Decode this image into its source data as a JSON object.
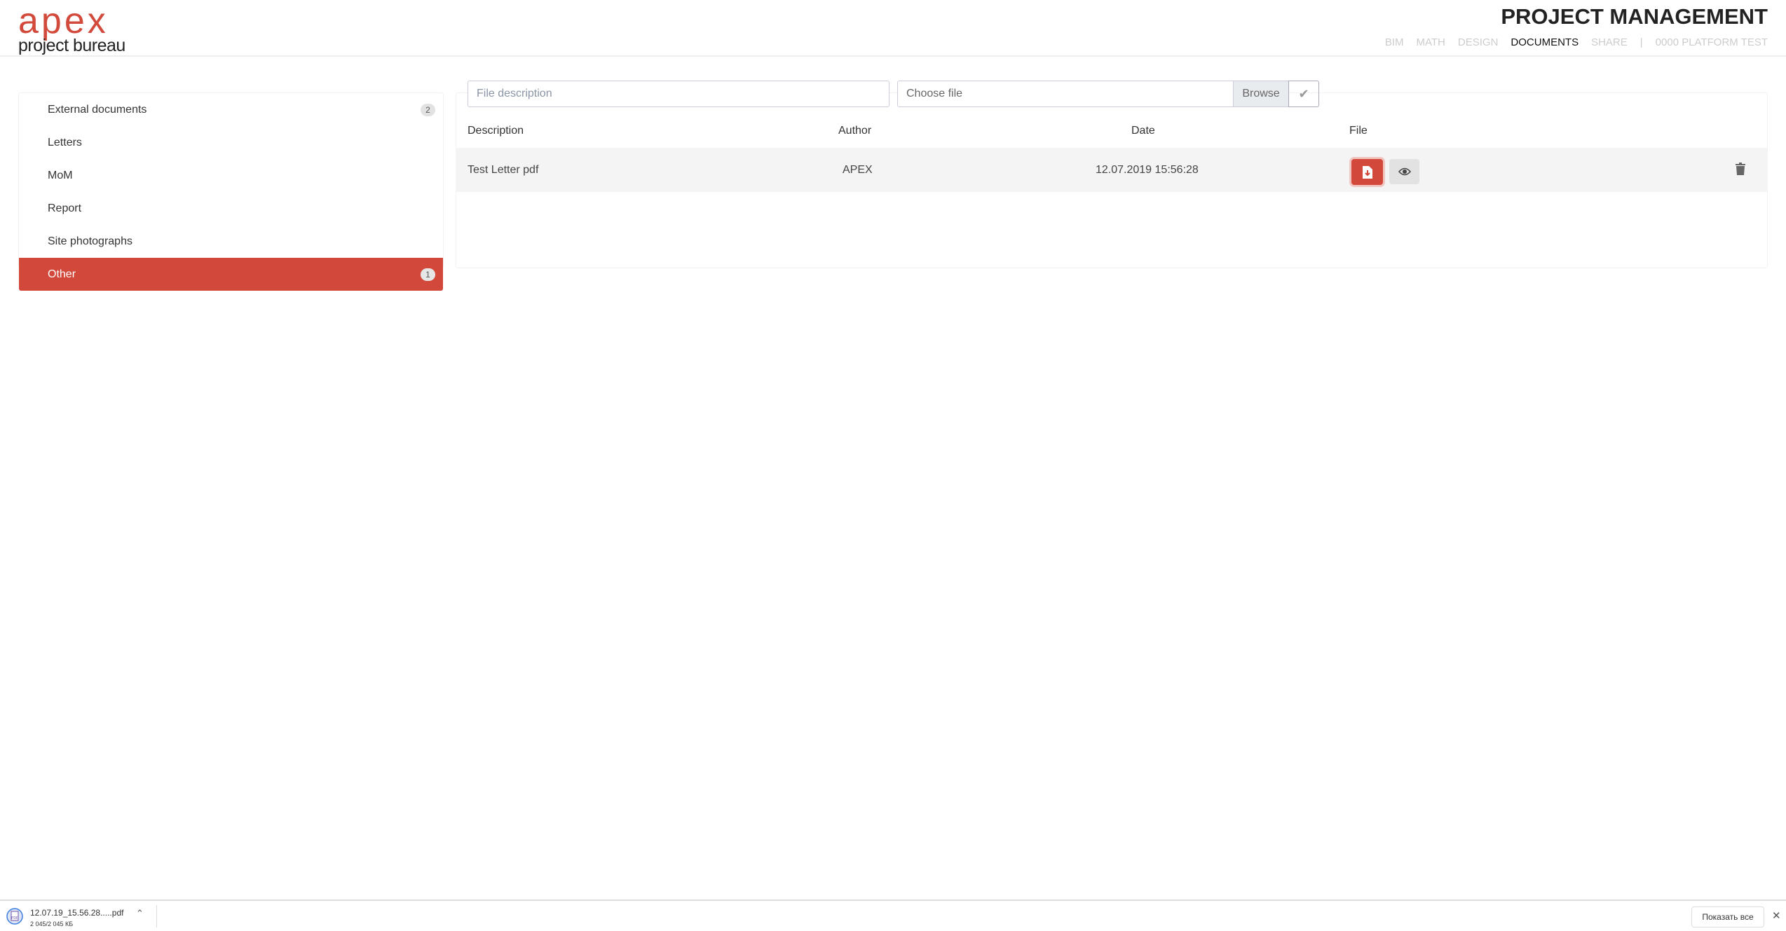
{
  "logo": {
    "main": "apex",
    "sub": "project bureau"
  },
  "header": {
    "title": "PROJECT MANAGEMENT",
    "nav": [
      "BIM",
      "MATH",
      "DESIGN",
      "DOCUMENTS",
      "SHARE",
      "|",
      "0000 PLATFORM TEST"
    ],
    "active_nav": "DOCUMENTS"
  },
  "sidebar": {
    "items": [
      {
        "label": "External documents",
        "count": "2"
      },
      {
        "label": "Letters"
      },
      {
        "label": "MoM"
      },
      {
        "label": "Report"
      },
      {
        "label": "Site photographs"
      },
      {
        "label": "Other",
        "count": "1",
        "active": true
      }
    ]
  },
  "upload": {
    "description_placeholder": "File description",
    "file_placeholder": "Choose file",
    "browse_label": "Browse",
    "submit_icon": "check-icon"
  },
  "table": {
    "headers": [
      "Description",
      "Author",
      "Date",
      "File"
    ],
    "rows": [
      {
        "description": "Test Letter pdf",
        "author": "APEX",
        "date": "12.07.2019 15:56:28"
      }
    ]
  },
  "downloads": {
    "file_name": "12.07.19_15.56.28.....pdf",
    "size": "2 045/2 045 КБ",
    "show_all": "Показать все",
    "close": "✕"
  },
  "colors": {
    "accent": "#d2483b"
  }
}
